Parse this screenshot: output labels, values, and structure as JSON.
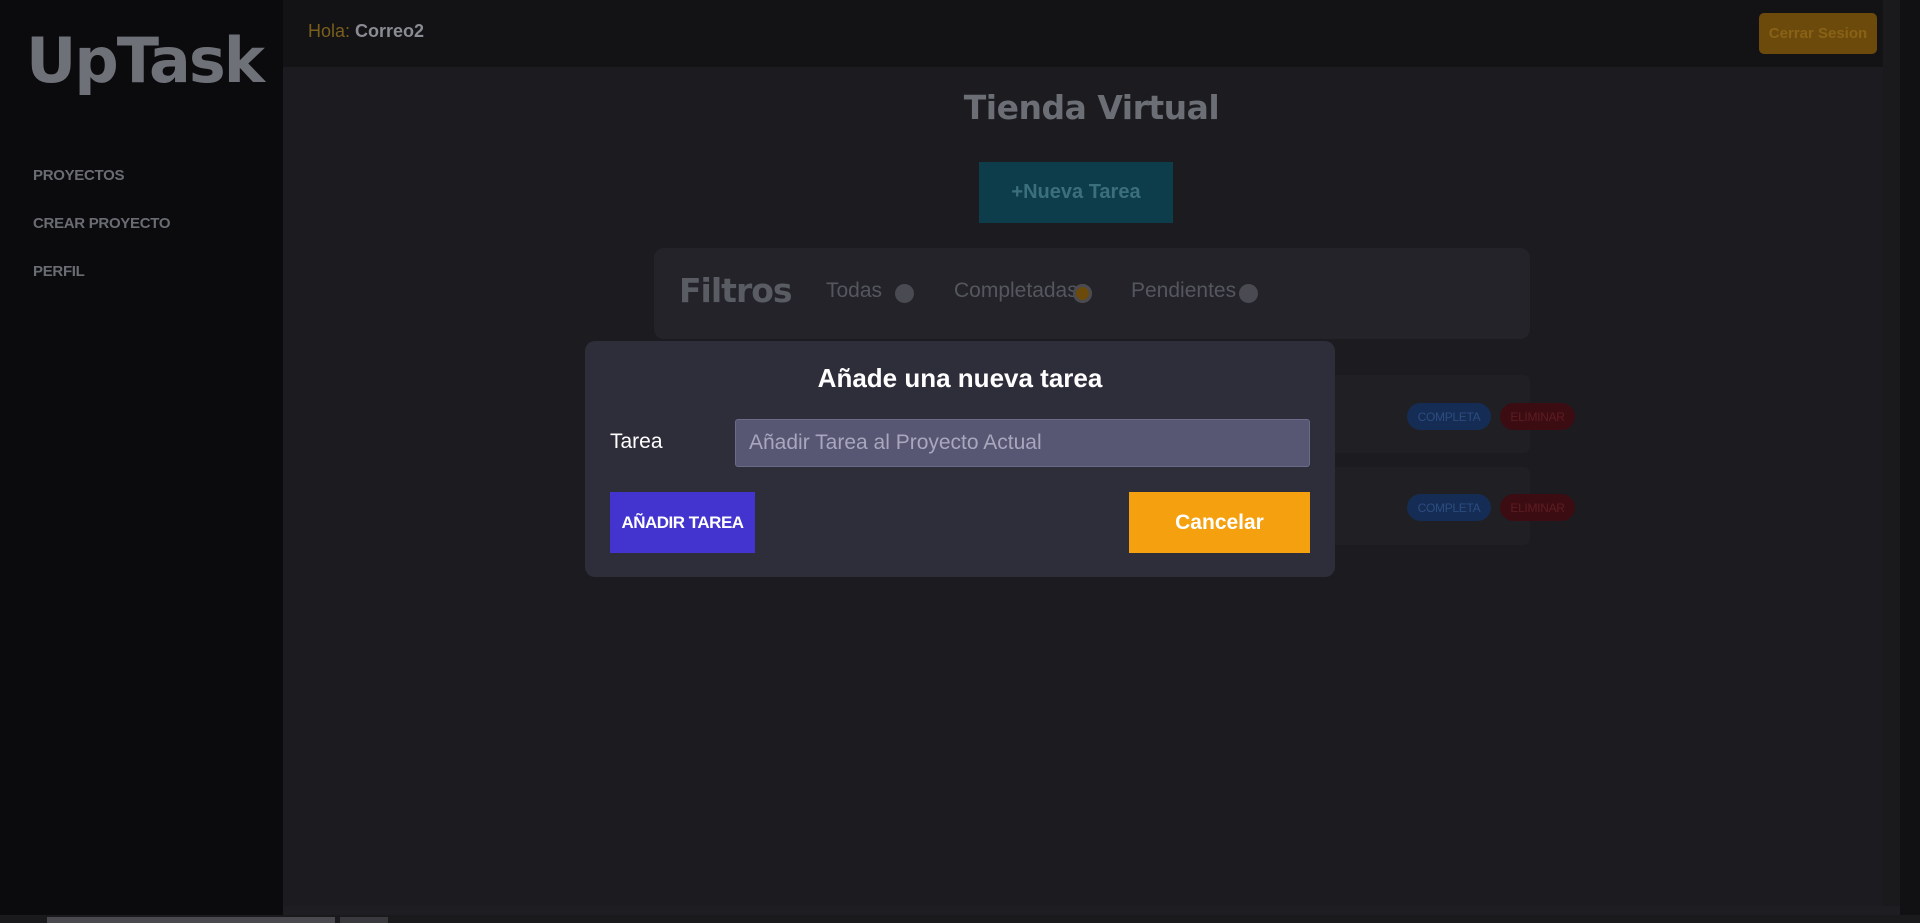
{
  "sidebar": {
    "logo": "UpTask",
    "items": [
      {
        "label": "PROYECTOS"
      },
      {
        "label": "CREAR PROYECTO"
      },
      {
        "label": "PERFIL"
      }
    ]
  },
  "header": {
    "greeting": "Hola:",
    "user": "Correo2",
    "logout_label": "Cerrar Sesion"
  },
  "project": {
    "title": "Tienda Virtual",
    "new_task_label": "+Nueva Tarea"
  },
  "filters": {
    "title": "Filtros",
    "options": [
      {
        "label": "Todas",
        "checked": false
      },
      {
        "label": "Completadas",
        "checked": true
      },
      {
        "label": "Pendientes",
        "checked": false
      }
    ]
  },
  "tasks": [
    {
      "complete_label": "COMPLETA",
      "delete_label": "ELIMINAR"
    },
    {
      "complete_label": "COMPLETA",
      "delete_label": "ELIMINAR"
    }
  ],
  "modal": {
    "title": "Añade una nueva tarea",
    "field_label": "Tarea",
    "field_placeholder": "Añadir Tarea al Proyecto Actual",
    "field_value": "",
    "add_label": "AÑADIR TAREA",
    "cancel_label": "Cancelar"
  },
  "colors": {
    "accent_orange": "#f5a10f",
    "accent_indigo": "#4334cf",
    "modal_bg": "#2e2d3a"
  }
}
